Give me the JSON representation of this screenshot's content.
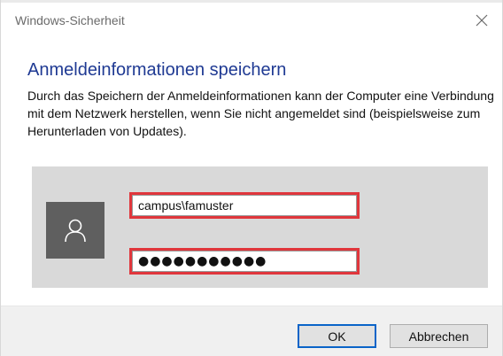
{
  "window": {
    "title": "Windows-Sicherheit",
    "close_icon": "close-icon"
  },
  "dialog": {
    "heading": "Anmeldeinformationen speichern",
    "description": "Durch das Speichern der Anmeldeinformationen kann der Computer eine Verbindung mit dem Netzwerk herstellen, wenn Sie nicht angemeldet sind (beispielsweise zum Herunterladen von Updates)."
  },
  "credentials": {
    "avatar_icon": "user-icon",
    "username_value": "campus\\famuster",
    "password_value": "●●●●●●●●●●●"
  },
  "buttons": {
    "ok_label": "OK",
    "cancel_label": "Abbrechen"
  },
  "colors": {
    "heading": "#1f3a93",
    "highlight": "#e0363c",
    "avatar_bg": "#5f5f5f",
    "panel_bg": "#d9d9d9",
    "footer_bg": "#f0f0f0",
    "focus_border": "#0a64c8"
  }
}
